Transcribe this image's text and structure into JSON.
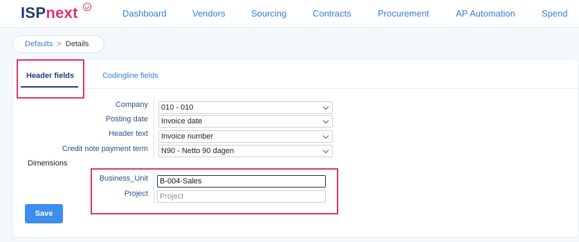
{
  "app": {
    "logo_main": "ISP",
    "logo_accent": "next"
  },
  "nav": {
    "items": [
      {
        "label": "Dashboard"
      },
      {
        "label": "Vendors"
      },
      {
        "label": "Sourcing"
      },
      {
        "label": "Contracts"
      },
      {
        "label": "Procurement"
      },
      {
        "label": "AP Automation"
      },
      {
        "label": "Spend"
      }
    ]
  },
  "breadcrumb": {
    "parent": "Defaults",
    "separator": ">",
    "current": "Details"
  },
  "tabs": [
    {
      "label": "Header fields",
      "active": true
    },
    {
      "label": "Codingline fields",
      "active": false
    }
  ],
  "fields": [
    {
      "label": "Company",
      "value": "010 - 010"
    },
    {
      "label": "Posting date",
      "value": "Invoice date"
    },
    {
      "label": "Header text",
      "value": "Invoice number"
    },
    {
      "label": "Credit note payment term",
      "value": "N90 - Netto 90 dagen"
    }
  ],
  "dimensions": {
    "title": "Dimensions",
    "items": [
      {
        "label": "Business_Unit",
        "value": "B-004-Sales",
        "placeholder": ""
      },
      {
        "label": "Project",
        "value": "",
        "placeholder": "Project"
      }
    ]
  },
  "actions": {
    "save_label": "Save"
  },
  "colors": {
    "brand": "#1f3c74",
    "accent": "#e0306a",
    "link": "#3a7bd5",
    "primary_button": "#3d8ef0"
  }
}
